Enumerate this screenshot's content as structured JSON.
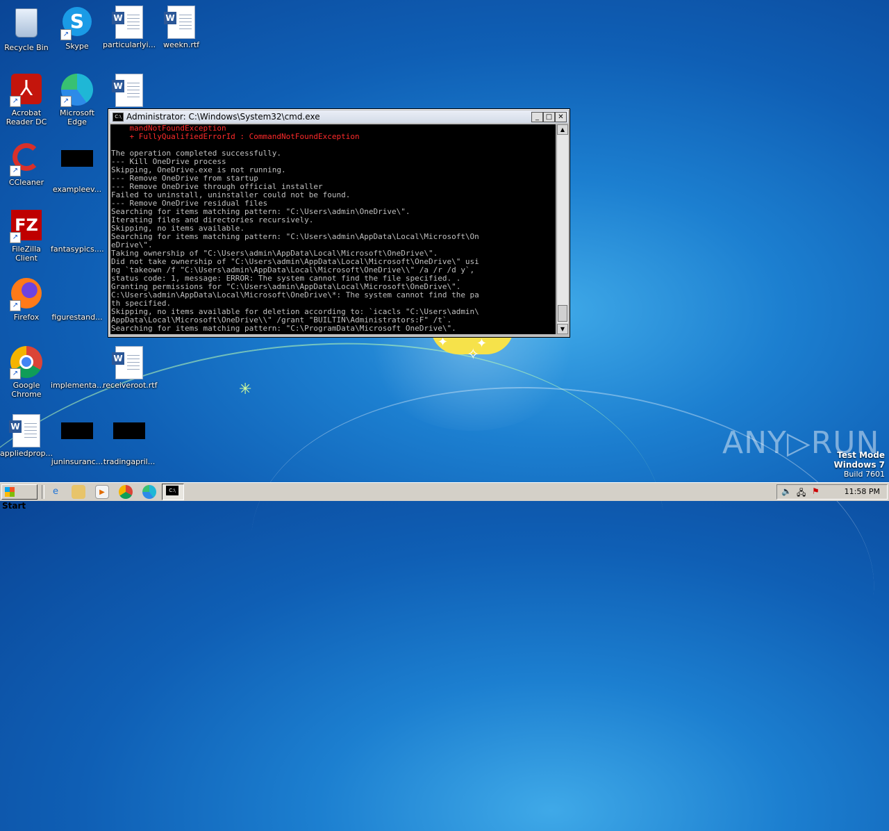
{
  "desktop": {
    "icons": [
      {
        "label": "Recycle Bin"
      },
      {
        "label": "Skype"
      },
      {
        "label": "particularlyi..."
      },
      {
        "label": "weekn.rtf"
      },
      {
        "label": "Acrobat Reader DC"
      },
      {
        "label": "Microsoft Edge"
      },
      {
        "label": "CCleaner"
      },
      {
        "label": "exampleev..."
      },
      {
        "label": "FileZilla Client"
      },
      {
        "label": "fantasypics...."
      },
      {
        "label": "Firefox"
      },
      {
        "label": "figurestand..."
      },
      {
        "label": "Google Chrome"
      },
      {
        "label": "implementa..."
      },
      {
        "label": "receiveroot.rtf"
      },
      {
        "label": "appliedprop..."
      },
      {
        "label": "juninsuranc..."
      },
      {
        "label": "tradingapril..."
      }
    ]
  },
  "cmd_window": {
    "title": "Administrator: C:\\Windows\\System32\\cmd.exe",
    "min_label": "_",
    "max_label": "□",
    "close_label": "✕",
    "lines": [
      {
        "text": "    mandNotFoundException",
        "error": true
      },
      {
        "text": "    + FullyQualifiedErrorId : CommandNotFoundException",
        "error": true
      },
      {
        "text": "",
        "error": false
      },
      {
        "text": "The operation completed successfully.",
        "error": false
      },
      {
        "text": "--- Kill OneDrive process",
        "error": false
      },
      {
        "text": "Skipping, OneDrive.exe is not running.",
        "error": false
      },
      {
        "text": "--- Remove OneDrive from startup",
        "error": false
      },
      {
        "text": "--- Remove OneDrive through official installer",
        "error": false
      },
      {
        "text": "Failed to uninstall, uninstaller could not be found.",
        "error": false
      },
      {
        "text": "--- Remove OneDrive residual files",
        "error": false
      },
      {
        "text": "Searching for items matching pattern: \"C:\\Users\\admin\\OneDrive\\\".",
        "error": false
      },
      {
        "text": "Iterating files and directories recursively.",
        "error": false
      },
      {
        "text": "Skipping, no items available.",
        "error": false
      },
      {
        "text": "Searching for items matching pattern: \"C:\\Users\\admin\\AppData\\Local\\Microsoft\\On",
        "error": false
      },
      {
        "text": "eDrive\\\".",
        "error": false
      },
      {
        "text": "Taking ownership of \"C:\\Users\\admin\\AppData\\Local\\Microsoft\\OneDrive\\\".",
        "error": false
      },
      {
        "text": "Did not take ownership of \"C:\\Users\\admin\\AppData\\Local\\Microsoft\\OneDrive\\\" usi",
        "error": false
      },
      {
        "text": "ng `takeown /f \"C:\\Users\\admin\\AppData\\Local\\Microsoft\\OneDrive\\\\\" /a /r /d y`,",
        "error": false
      },
      {
        "text": "status code: 1, message: ERROR: The system cannot find the file specified. .",
        "error": false
      },
      {
        "text": "Granting permissions for \"C:\\Users\\admin\\AppData\\Local\\Microsoft\\OneDrive\\\".",
        "error": false
      },
      {
        "text": "C:\\Users\\admin\\AppData\\Local\\Microsoft\\OneDrive\\*: The system cannot find the pa",
        "error": false
      },
      {
        "text": "th specified.",
        "error": false
      },
      {
        "text": "Skipping, no items available for deletion according to: `icacls \"C:\\Users\\admin\\",
        "error": false
      },
      {
        "text": "AppData\\Local\\Microsoft\\OneDrive\\\\\" /grant \"BUILTIN\\Administrators:F\" /t`.",
        "error": false
      },
      {
        "text": "Searching for items matching pattern: \"C:\\ProgramData\\Microsoft OneDrive\\\".",
        "error": false
      }
    ]
  },
  "watermark": {
    "brand": "ANY▷RUN",
    "mode": "Test Mode",
    "os": "Windows 7",
    "build": "Build 7601"
  },
  "taskbar": {
    "start_label": "Start",
    "clock": "11:58 PM"
  }
}
